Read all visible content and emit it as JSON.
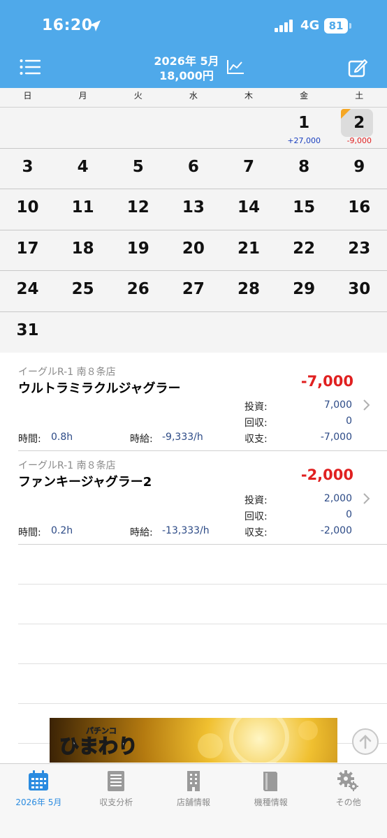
{
  "status": {
    "time": "16:20",
    "network": "4G",
    "battery": "81"
  },
  "header": {
    "title_month": "2026年 5月",
    "title_total": "18,000円"
  },
  "weekdays": [
    "日",
    "月",
    "火",
    "水",
    "木",
    "金",
    "土"
  ],
  "days": {
    "d1": "1",
    "d1_amt": "+27,000",
    "d2": "2",
    "d2_amt": "-9,000",
    "d3": "3",
    "d4": "4",
    "d5": "5",
    "d6": "6",
    "d7": "7",
    "d8": "8",
    "d9": "9",
    "d10": "10",
    "d11": "11",
    "d12": "12",
    "d13": "13",
    "d14": "14",
    "d15": "15",
    "d16": "16",
    "d17": "17",
    "d18": "18",
    "d19": "19",
    "d20": "20",
    "d21": "21",
    "d22": "22",
    "d23": "23",
    "d24": "24",
    "d25": "25",
    "d26": "26",
    "d27": "27",
    "d28": "28",
    "d29": "29",
    "d30": "30",
    "d31": "31"
  },
  "records": [
    {
      "store": "イーグルR-1 南８条店",
      "machine": "ウルトラミラクルジャグラー",
      "result": "-7,000",
      "invest_label": "投資:",
      "invest": "7,000",
      "recover_label": "回収:",
      "recover": "0",
      "balance_label": "収支:",
      "balance": "-7,000",
      "time_label": "時間:",
      "time": "0.8h",
      "rate_label": "時給:",
      "rate": "-9,333/h"
    },
    {
      "store": "イーグルR-1 南８条店",
      "machine": "ファンキージャグラー2",
      "result": "-2,000",
      "invest_label": "投資:",
      "invest": "2,000",
      "recover_label": "回収:",
      "recover": "0",
      "balance_label": "収支:",
      "balance": "-2,000",
      "time_label": "時間:",
      "time": "0.2h",
      "rate_label": "時給:",
      "rate": "-13,333/h"
    }
  ],
  "banner": {
    "small": "パチンコ",
    "logo": "ひまわり"
  },
  "tabs": [
    {
      "label": "2026年 5月",
      "icon": "calendar-icon"
    },
    {
      "label": "収支分析",
      "icon": "report-icon"
    },
    {
      "label": "店舗情報",
      "icon": "building-icon"
    },
    {
      "label": "機種情報",
      "icon": "book-icon"
    },
    {
      "label": "その他",
      "icon": "gear-icon"
    }
  ],
  "colors": {
    "header": "#4fa9ea",
    "positive": "#1a3fbf",
    "negative": "#e02020",
    "active_tab": "#2a8be0",
    "today_marker": "#f5a623"
  }
}
